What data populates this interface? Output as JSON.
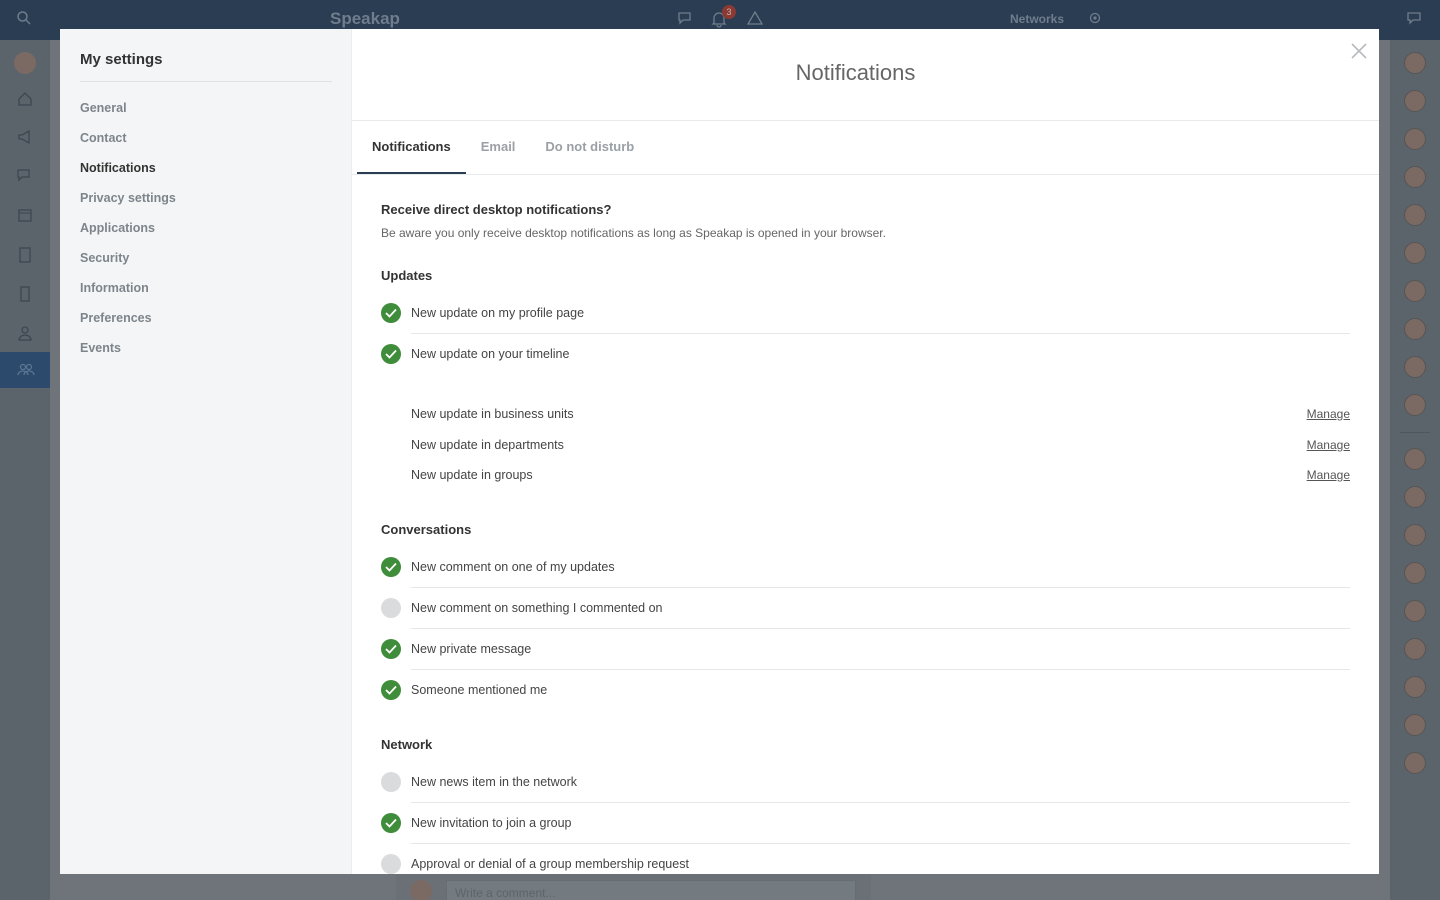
{
  "background": {
    "brand": "Speakap",
    "bell_badge": "3",
    "networks_label": "Networks",
    "comment_placeholder": "Write a comment..."
  },
  "settings": {
    "title": "My settings",
    "nav": [
      "General",
      "Contact",
      "Notifications",
      "Privacy settings",
      "Applications",
      "Security",
      "Information",
      "Preferences",
      "Events"
    ],
    "active_nav": "Notifications"
  },
  "modal": {
    "title": "Notifications",
    "tabs": [
      "Notifications",
      "Email",
      "Do not disturb"
    ],
    "active_tab": "Notifications"
  },
  "intro": {
    "question": "Receive direct desktop notifications?",
    "text": "Be aware you only receive desktop notifications as long as Speakap is opened in your browser."
  },
  "sections": {
    "updates": {
      "heading": "Updates",
      "items": [
        {
          "label": "New update on my profile page",
          "checked": true
        },
        {
          "label": "New update on your timeline",
          "checked": true
        }
      ],
      "sub_items": [
        {
          "label": "New update in business units",
          "action": "Manage"
        },
        {
          "label": "New update in departments",
          "action": "Manage"
        },
        {
          "label": "New update in groups",
          "action": "Manage"
        }
      ]
    },
    "conversations": {
      "heading": "Conversations",
      "items": [
        {
          "label": "New comment on one of my updates",
          "checked": true
        },
        {
          "label": "New comment on something I commented on",
          "checked": false
        },
        {
          "label": "New private message",
          "checked": true
        },
        {
          "label": "Someone mentioned me",
          "checked": true
        }
      ]
    },
    "network": {
      "heading": "Network",
      "items": [
        {
          "label": "New news item in the network",
          "checked": false
        },
        {
          "label": "New invitation to join a group",
          "checked": true
        },
        {
          "label": "Approval or denial of a group membership request",
          "checked": false
        }
      ]
    }
  },
  "colors": {
    "checked": "#3f8c3a",
    "unchecked": "#d9dbdd",
    "topbar": "#2b3d52"
  }
}
